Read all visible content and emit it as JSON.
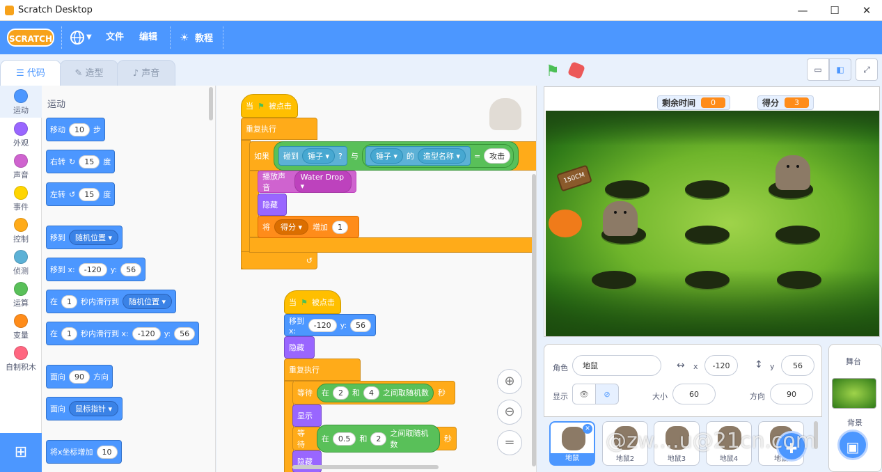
{
  "window": {
    "title": "Scratch Desktop",
    "minimize": "—",
    "maximize": "☐",
    "close": "✕"
  },
  "menu": {
    "logo": "SCRATCH",
    "lang_icon": "globe-icon",
    "file": "文件",
    "edit": "编辑",
    "tutorials": "教程"
  },
  "tabs": [
    {
      "label": "代码"
    },
    {
      "label": "造型"
    },
    {
      "label": "声音"
    }
  ],
  "categories": [
    {
      "label": "运动",
      "color": "#4c97ff"
    },
    {
      "label": "外观",
      "color": "#9966ff"
    },
    {
      "label": "声音",
      "color": "#cf63cf"
    },
    {
      "label": "事件",
      "color": "#ffd500"
    },
    {
      "label": "控制",
      "color": "#ffab19"
    },
    {
      "label": "侦测",
      "color": "#5cb1d6"
    },
    {
      "label": "运算",
      "color": "#59c059"
    },
    {
      "label": "变量",
      "color": "#ff8c1a"
    },
    {
      "label": "自制积木",
      "color": "#ff6680"
    }
  ],
  "palette": {
    "heading": "运动",
    "move": {
      "a": "移动",
      "v": "10",
      "b": "步"
    },
    "turn_right": {
      "a": "右转",
      "v": "15",
      "b": "度"
    },
    "turn_left": {
      "a": "左转",
      "v": "15",
      "b": "度"
    },
    "goto": {
      "a": "移到",
      "dd": "随机位置"
    },
    "goto_xy": {
      "a": "移到 x:",
      "x": "-120",
      "b": "y:",
      "y": "56"
    },
    "glide": {
      "a": "在",
      "v": "1",
      "b": "秒内滑行到",
      "dd": "随机位置"
    },
    "glide_xy": {
      "a": "在",
      "v": "1",
      "b": "秒内滑行到 x:",
      "x": "-120",
      "c": "y:",
      "y": "56"
    },
    "point_dir": {
      "a": "面向",
      "v": "90",
      "b": "方向"
    },
    "point_to": {
      "a": "面向",
      "dd": "鼠标指针"
    },
    "change_x": {
      "a": "将x坐标增加",
      "v": "10"
    }
  },
  "script1": {
    "hat": {
      "a": "当",
      "b": "被点击"
    },
    "forever": "重复执行",
    "if": "如果",
    "touching": {
      "a": "碰到",
      "dd": "锤子",
      "q": "?"
    },
    "and": "与",
    "of": {
      "dd1": "锤子",
      "mid": "的",
      "dd2": "造型名称"
    },
    "eq": "=",
    "eq_val": "攻击",
    "play": {
      "a": "播放声音",
      "dd": "Water Drop"
    },
    "hide": "隐藏",
    "change": {
      "a": "将",
      "dd": "得分",
      "b": "增加",
      "v": "1"
    }
  },
  "script2": {
    "hat": {
      "a": "当",
      "b": "被点击"
    },
    "goto": {
      "a": "移到 x:",
      "x": "-120",
      "b": "y:",
      "y": "56"
    },
    "hide": "隐藏",
    "forever": "重复执行",
    "wait1": {
      "a": "等待",
      "in": "在",
      "v1": "2",
      "and": "和",
      "v2": "4",
      "b": "之间取随机数",
      "c": "秒"
    },
    "show": "显示",
    "wait2": {
      "a": "等待",
      "in": "在",
      "v1": "0.5",
      "and": "和",
      "v2": "2",
      "b": "之间取随机数",
      "c": "秒"
    },
    "hide2": "隐藏"
  },
  "stage": {
    "timer_label": "剩余时间",
    "timer_value": "0",
    "score_label": "得分",
    "score_value": "3",
    "sign": "150CM"
  },
  "sprite_info": {
    "sprite_label": "角色",
    "sprite_name": "地鼠",
    "x_label": "x",
    "x": "-120",
    "y_label": "y",
    "y": "56",
    "show_label": "显示",
    "size_label": "大小",
    "size": "60",
    "dir_label": "方向",
    "dir": "90"
  },
  "sprites": [
    {
      "name": "地鼠"
    },
    {
      "name": "地鼠2"
    },
    {
      "name": "地鼠3"
    },
    {
      "name": "地鼠4"
    },
    {
      "name": "地鼠"
    }
  ],
  "stage_pane": {
    "title": "舞台",
    "backdrop_label": "背景"
  },
  "watermark": "@zw....u@21cn.com"
}
